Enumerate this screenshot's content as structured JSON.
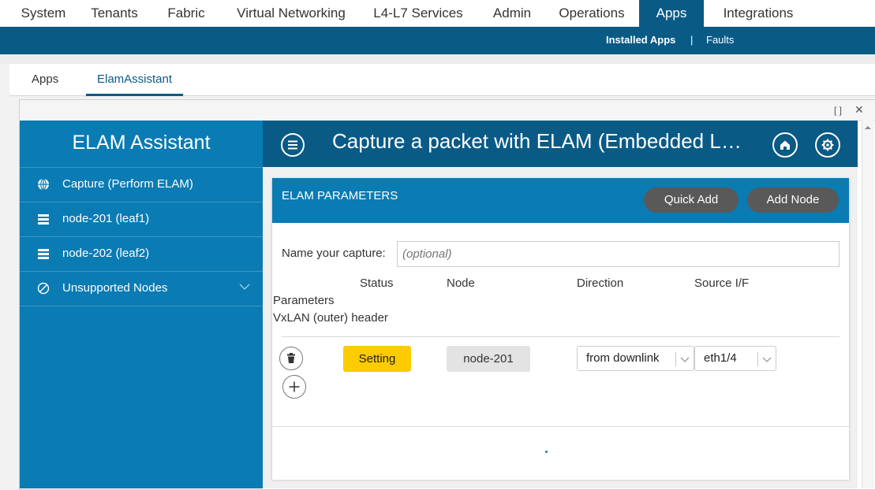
{
  "top_nav": {
    "items": [
      "System",
      "Tenants",
      "Fabric",
      "Virtual Networking",
      "L4-L7 Services",
      "Admin",
      "Operations",
      "Apps",
      "Integrations"
    ],
    "active": "Apps"
  },
  "sub_nav": {
    "installed_apps": "Installed Apps",
    "separator": "|",
    "faults": "Faults"
  },
  "tabs": [
    "Apps",
    "ElamAssistant"
  ],
  "sidebar": {
    "title": "ELAM Assistant",
    "items": [
      {
        "label": "Capture (Perform ELAM)",
        "icon": "globe-icon"
      },
      {
        "label": "node-201 (leaf1)",
        "icon": "switch-icon"
      },
      {
        "label": "node-202 (leaf2)",
        "icon": "switch-icon"
      },
      {
        "label": "Unsupported Nodes",
        "icon": "ban-icon"
      }
    ]
  },
  "main": {
    "title": "Capture a packet with ELAM (Embedded L…"
  },
  "card": {
    "title": "ELAM PARAMETERS",
    "quick_add": "Quick Add",
    "add_node": "Add Node",
    "name_label": "Name your capture:",
    "name_placeholder": "(optional)",
    "columns": {
      "status": "Status",
      "node": "Node",
      "direction": "Direction",
      "source_if": "Source I/F",
      "parameters": "Parameters",
      "vxlan": "VxLAN (outer) header"
    },
    "row": {
      "status": "Setting",
      "node": "node-201",
      "direction": "from downlink",
      "source_if": "eth1/4"
    }
  },
  "colors": {
    "header_dark": "#0a5a86",
    "sidebar_blue": "#0a7bb3",
    "status_yellow": "#fccb00",
    "pill_gray": "#595959"
  }
}
